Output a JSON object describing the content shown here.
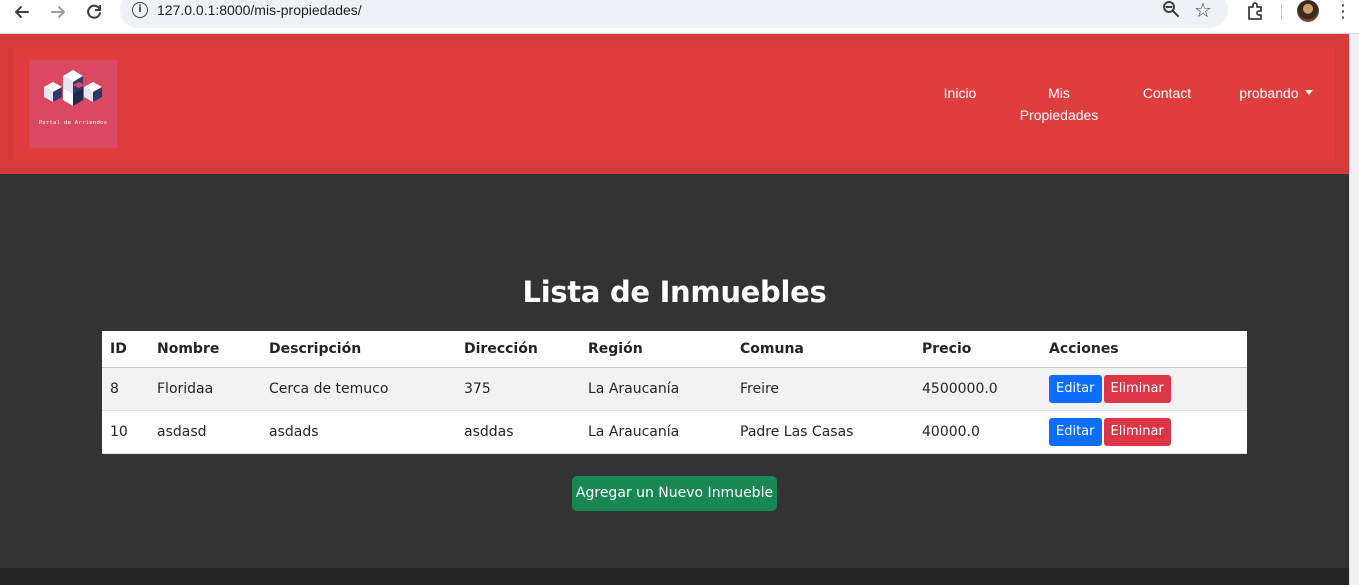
{
  "browser": {
    "url": "127.0.0.1:8000/mis-propiedades/"
  },
  "navbar": {
    "logo_text": "Portal de Arriendos",
    "links": {
      "inicio": "Inicio",
      "mis_propiedades_1": "Mis",
      "mis_propiedades_2": "Propiedades",
      "contact": "Contact",
      "user": "probando"
    }
  },
  "main": {
    "title": "Lista de Inmuebles",
    "table": {
      "headers": [
        "ID",
        "Nombre",
        "Descripción",
        "Dirección",
        "Región",
        "Comuna",
        "Precio",
        "Acciones"
      ],
      "rows": [
        {
          "id": "8",
          "nombre": "Floridaa",
          "descripcion": "Cerca de temuco",
          "direccion": "375",
          "region": "La Araucanía",
          "comuna": "Freire",
          "precio": "4500000.0"
        },
        {
          "id": "10",
          "nombre": "asdasd",
          "descripcion": "asdads",
          "direccion": "asddas",
          "region": "La Araucanía",
          "comuna": "Padre Las Casas",
          "precio": "40000.0"
        }
      ],
      "edit_label": "Editar",
      "delete_label": "Eliminar"
    },
    "add_button": "Agregar un Nuevo Inmueble"
  },
  "colors": {
    "header_red": "#e03d3f",
    "page_background": "#333333",
    "edit_blue": "#0d6efd",
    "delete_red": "#dc3545",
    "add_green": "#198754"
  }
}
